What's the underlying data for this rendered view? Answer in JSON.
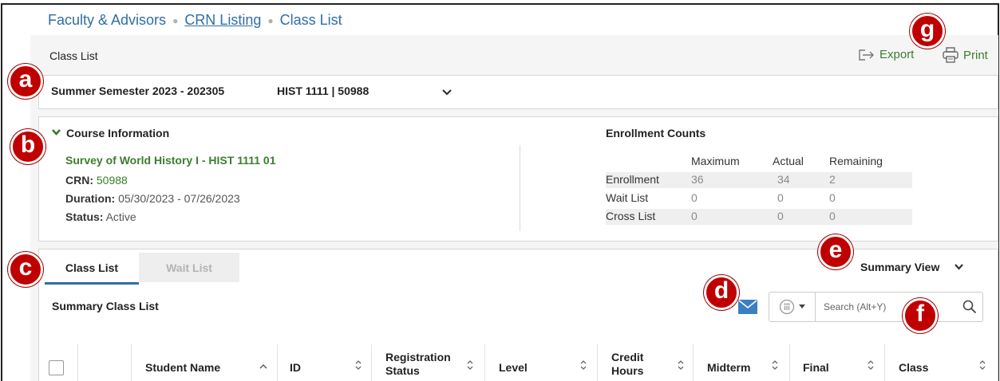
{
  "breadcrumb": {
    "items": [
      {
        "label": "Faculty & Advisors"
      },
      {
        "label": "CRN Listing"
      },
      {
        "label": "Class List"
      }
    ]
  },
  "page": {
    "title": "Class List",
    "export_label": "Export",
    "print_label": "Print"
  },
  "term": {
    "semester": "Summer Semester 2023 - 202305",
    "course": "HIST 1111 | 50988"
  },
  "course_info": {
    "header": "Course Information",
    "name": "Survey of World History I - HIST 1111 01",
    "crn_label": "CRN:",
    "crn_value": "50988",
    "duration_label": "Duration:",
    "duration_value": "05/30/2023 - 07/26/2023",
    "status_label": "Status:",
    "status_value": "Active"
  },
  "enrollment": {
    "header": "Enrollment Counts",
    "columns": [
      "Maximum",
      "Actual",
      "Remaining"
    ],
    "rows": [
      {
        "label": "Enrollment",
        "maximum": "36",
        "actual": "34",
        "remaining": "2"
      },
      {
        "label": "Wait List",
        "maximum": "0",
        "actual": "0",
        "remaining": "0"
      },
      {
        "label": "Cross List",
        "maximum": "0",
        "actual": "0",
        "remaining": "0"
      }
    ]
  },
  "tabs": [
    {
      "label": "Class List",
      "active": true
    },
    {
      "label": "Wait List",
      "active": false
    }
  ],
  "view": {
    "selector_label": "Summary View",
    "section_title": "Summary Class List"
  },
  "search": {
    "placeholder": "Search (Alt+Y)"
  },
  "table": {
    "columns": [
      {
        "label": "Student Name",
        "line2": ""
      },
      {
        "label": "ID",
        "line2": ""
      },
      {
        "label": "Registration",
        "line2": "Status"
      },
      {
        "label": "Level",
        "line2": ""
      },
      {
        "label": "Credit",
        "line2": "Hours"
      },
      {
        "label": "Midterm",
        "line2": ""
      },
      {
        "label": "Final",
        "line2": ""
      },
      {
        "label": "Class",
        "line2": ""
      }
    ]
  },
  "callouts": [
    "a",
    "b",
    "c",
    "d",
    "e",
    "f",
    "g"
  ],
  "colors": {
    "link_blue": "#2f6ea4",
    "accent_green": "#3c7d2e",
    "callout_red": "#c00000",
    "email_blue": "#3a7fc1"
  }
}
